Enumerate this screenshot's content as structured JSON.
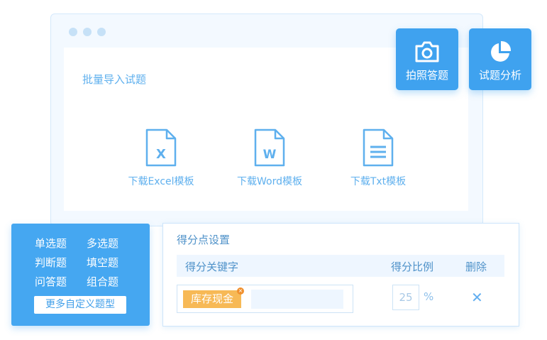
{
  "window": {
    "import_title": "批量导入试题",
    "templates": [
      {
        "label": "下载Excel模板",
        "letter": "X"
      },
      {
        "label": "下载Word模板",
        "letter": "W"
      },
      {
        "label": "下载Txt模板",
        "letter": ""
      }
    ]
  },
  "feature_buttons": {
    "photo": {
      "label": "拍照答题",
      "icon": "camera-icon"
    },
    "analysis": {
      "label": "试题分析",
      "icon": "pie-chart-icon"
    }
  },
  "question_types": {
    "items": [
      "单选题",
      "多选题",
      "判断题",
      "填空题",
      "问答题",
      "组合题"
    ],
    "more_label": "更多自定义题型"
  },
  "score_settings": {
    "title": "得分点设置",
    "headers": {
      "keyword": "得分关键字",
      "ratio": "得分比例",
      "delete": "删除"
    },
    "row": {
      "tag": "库存现金",
      "keyword_input": "",
      "ratio": "25",
      "percent": "%",
      "delete_symbol": "✕"
    }
  },
  "colors": {
    "accent": "#3fa2ef",
    "accent_light": "#5fb0ee",
    "tag": "#f7b956",
    "panel_bg": "#f3f9ff"
  }
}
